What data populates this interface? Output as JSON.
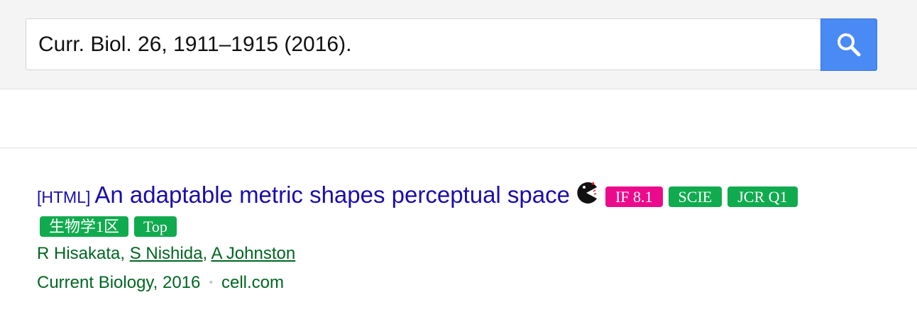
{
  "search": {
    "query": "Curr. Biol. 26, 1911–1915 (2016)."
  },
  "result": {
    "type_tag": "[HTML]",
    "title": "An adaptable metric shapes perceptual space",
    "badges_row1": [
      "IF 8.1",
      "SCIE",
      "JCR Q1"
    ],
    "badges_row2": [
      "生物学1区",
      "Top"
    ],
    "authors": {
      "plain": "R Hisakata",
      "sep1": ", ",
      "link1": "S Nishida",
      "sep2": ", ",
      "link2": "A Johnston"
    },
    "source": {
      "venue": "Current Biology, 2016",
      "separator": "•",
      "domain": "cell.com"
    }
  },
  "icons": {
    "search_button": "search-icon",
    "extension": "pacman-icon"
  },
  "colors": {
    "link_blue": "#1a0dab",
    "green_text": "#006621",
    "search_button": "#4a8af4",
    "badge_pink": "#ec0a8c",
    "badge_green": "#10ab4e"
  }
}
